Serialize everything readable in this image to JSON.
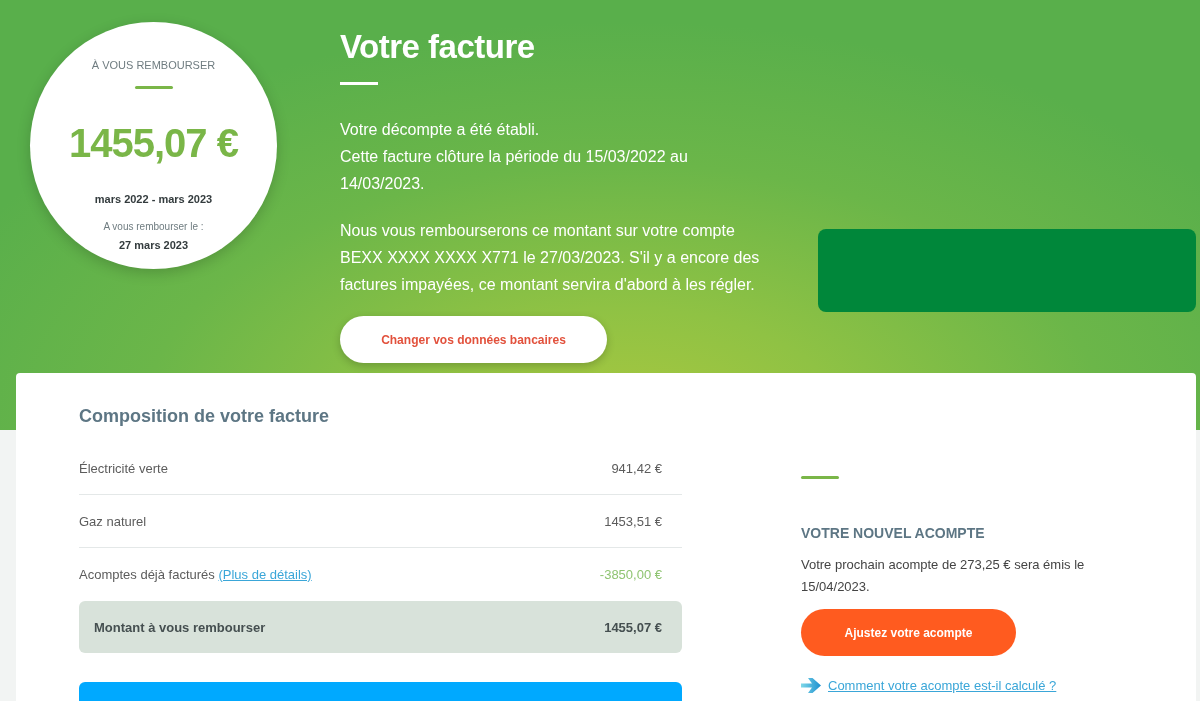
{
  "summary_circle": {
    "label": "À VOUS REMBOURSER",
    "amount": "1455,07 €",
    "period": "mars 2022 - mars 2023",
    "refund_date_label": "A vous rembourser le :",
    "refund_date": "27 mars 2023"
  },
  "invoice_intro": {
    "title": "Votre facture",
    "paragraphs": [
      [
        "Votre décompte a été établi.",
        "Cette facture clôture la période du 15/03/2022 au 14/03/2023."
      ],
      [
        "Nous vous rembourserons ce montant sur votre compte BEXX XXXX XXXX X771 le 27/03/2023. S'il y a encore des factures impayées, ce montant servira d'abord à les régler."
      ]
    ],
    "button": "Changer vos données bancaires"
  },
  "composition": {
    "title": "Composition de votre facture",
    "rows": [
      {
        "kind": "line",
        "label": "Électricité verte",
        "value": "941,42 €"
      },
      {
        "kind": "line",
        "label": "Gaz naturel",
        "value": "1453,51 €"
      },
      {
        "kind": "credit",
        "label": "Acomptes déjà facturés",
        "link": "(Plus de détails)",
        "value": "-3850,00 €"
      },
      {
        "kind": "total",
        "label": "Montant à vous rembourser",
        "value": "1455,07 €"
      }
    ]
  },
  "new_installment": {
    "title": "VOTRE NOUVEL ACOMPTE",
    "text": "Votre prochain acompte de 273,25 € sera émis le 15/04/2023.",
    "button": "Ajustez votre acompte",
    "link": "Comment votre acompte est-il calculé ?"
  }
}
